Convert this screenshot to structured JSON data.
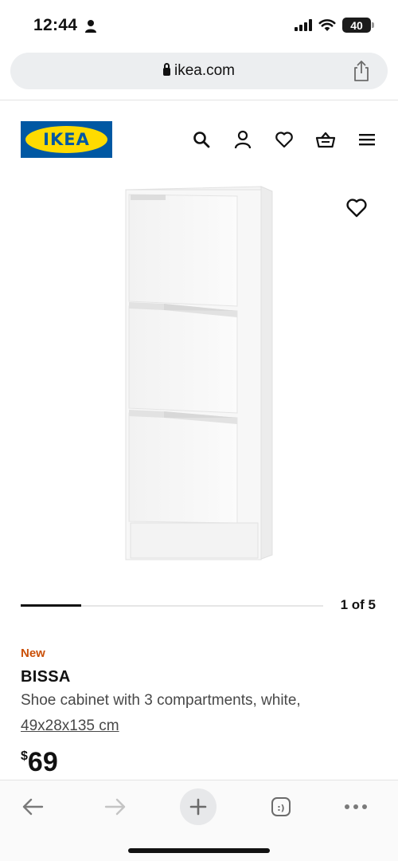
{
  "status_bar": {
    "time": "12:44",
    "battery": "40"
  },
  "browser": {
    "url": "ikea.com"
  },
  "header": {
    "logo_text": "IKEA"
  },
  "product": {
    "badge": "New",
    "name": "BISSA",
    "description": "Shoe cabinet with 3 compartments, white,",
    "dimensions": "49x28x135 cm",
    "price_currency": "$",
    "price": "69",
    "image_counter": "1 of 5",
    "carousel_progress_fraction": 0.2
  },
  "colors": {
    "ikea_blue": "#0058a3",
    "ikea_yellow": "#ffdb00",
    "new_badge": "#ca5008",
    "toolbar_icon_gray": "#7a7a7a"
  },
  "icons": {
    "header": [
      "search-icon",
      "account-icon",
      "heart-icon",
      "basket-icon",
      "menu-icon"
    ],
    "toolbar": [
      "back-arrow-icon",
      "forward-arrow-icon",
      "plus-icon",
      "tabs-icon",
      "more-icon"
    ]
  }
}
